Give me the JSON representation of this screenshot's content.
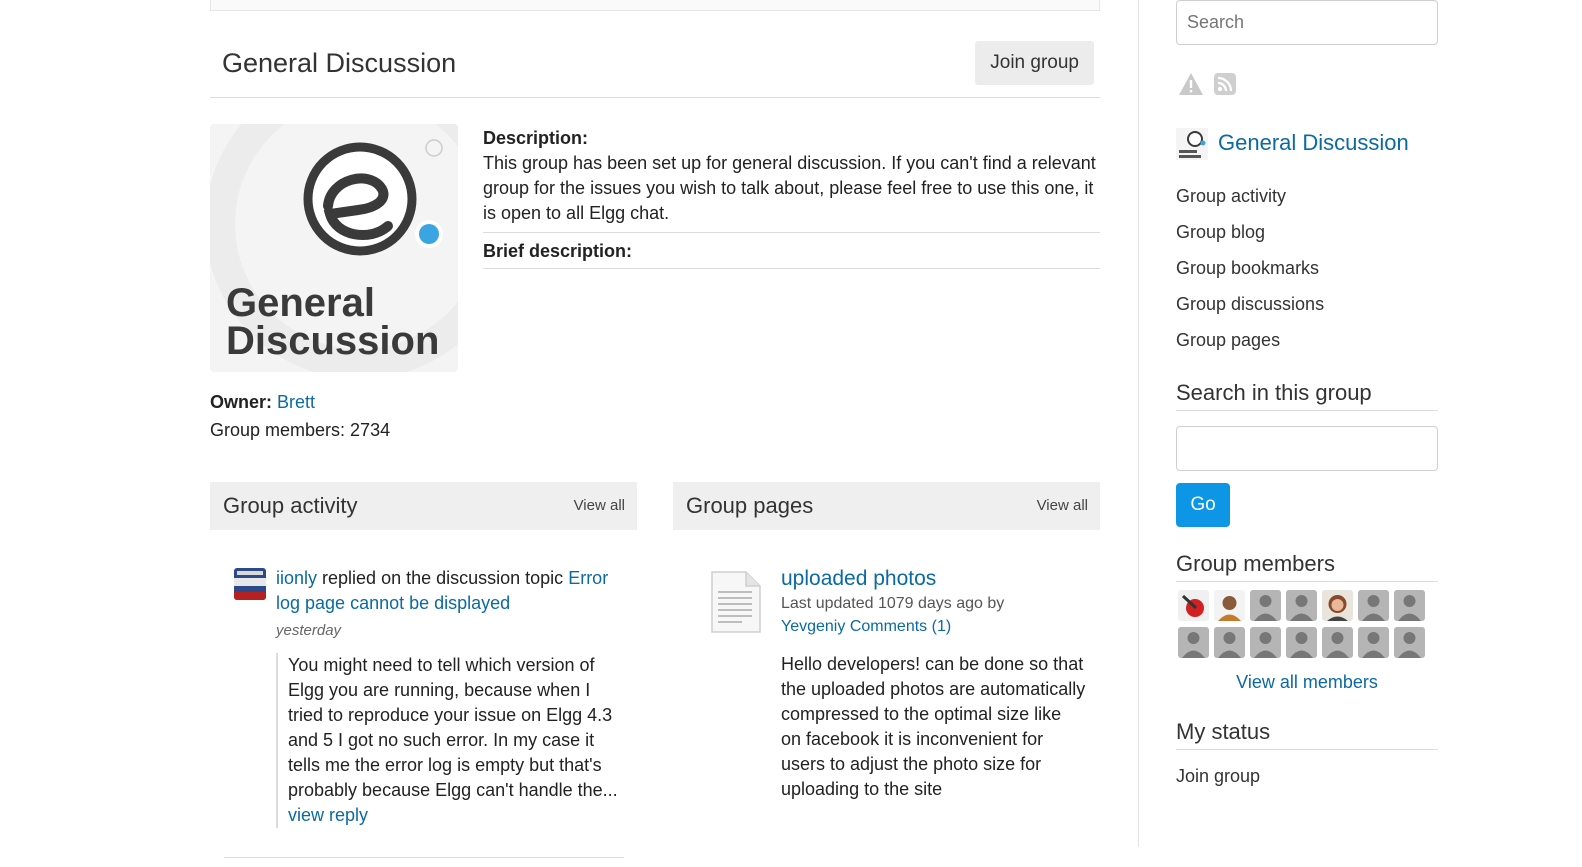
{
  "search": {
    "placeholder": "Search"
  },
  "group": {
    "title": "General Discussion",
    "join_label": "Join group",
    "logo_line1": "General",
    "logo_line2": "Discussion",
    "description_label": "Description:",
    "description_text": "This group has been set up for general discussion. If you can't find a relevant group for the issues you wish to talk about, please feel free to use this one, it is open to all Elgg chat.",
    "brief_label": "Brief description:",
    "owner_label": "Owner:",
    "owner_name": "Brett",
    "members_text": "Group members: 2734"
  },
  "activity": {
    "title": "Group activity",
    "view_all": "View all",
    "item": {
      "user": "iionly",
      "action": " replied on the discussion topic ",
      "topic": "Error log page cannot be displayed",
      "time": "yesterday",
      "excerpt": "You might need to tell which version of Elgg you are running, because when I tried to reproduce your issue on Elgg 4.3 and 5 I got no such error. In my case it tells me the error log is empty but that's probably because Elgg can't handle the... ",
      "reply_link": "view reply"
    }
  },
  "pages": {
    "title": "Group pages",
    "view_all": "View all",
    "item": {
      "title": "uploaded photos",
      "meta": "Last updated 1079 days ago by",
      "author": "Yevgeniy",
      "comments": "Comments (1)",
      "excerpt": "Hello developers! can be done so that the uploaded photos are automatically compressed to the optimal size like on facebook  it is inconvenient for users to adjust the photo size for uploading to the site"
    }
  },
  "sidebar": {
    "group_name": "General Discussion",
    "menu": [
      "Group activity",
      "Group blog",
      "Group bookmarks",
      "Group discussions",
      "Group pages"
    ],
    "search_group_title": "Search in this group",
    "go_label": "Go",
    "members_title": "Group members",
    "view_all_members": "View all members",
    "my_status_title": "My status",
    "status_link": "Join group"
  },
  "colors": {
    "link": "#0b6aa2",
    "go_button": "#0d95e6",
    "logo_dot": "#3aa5e0"
  }
}
